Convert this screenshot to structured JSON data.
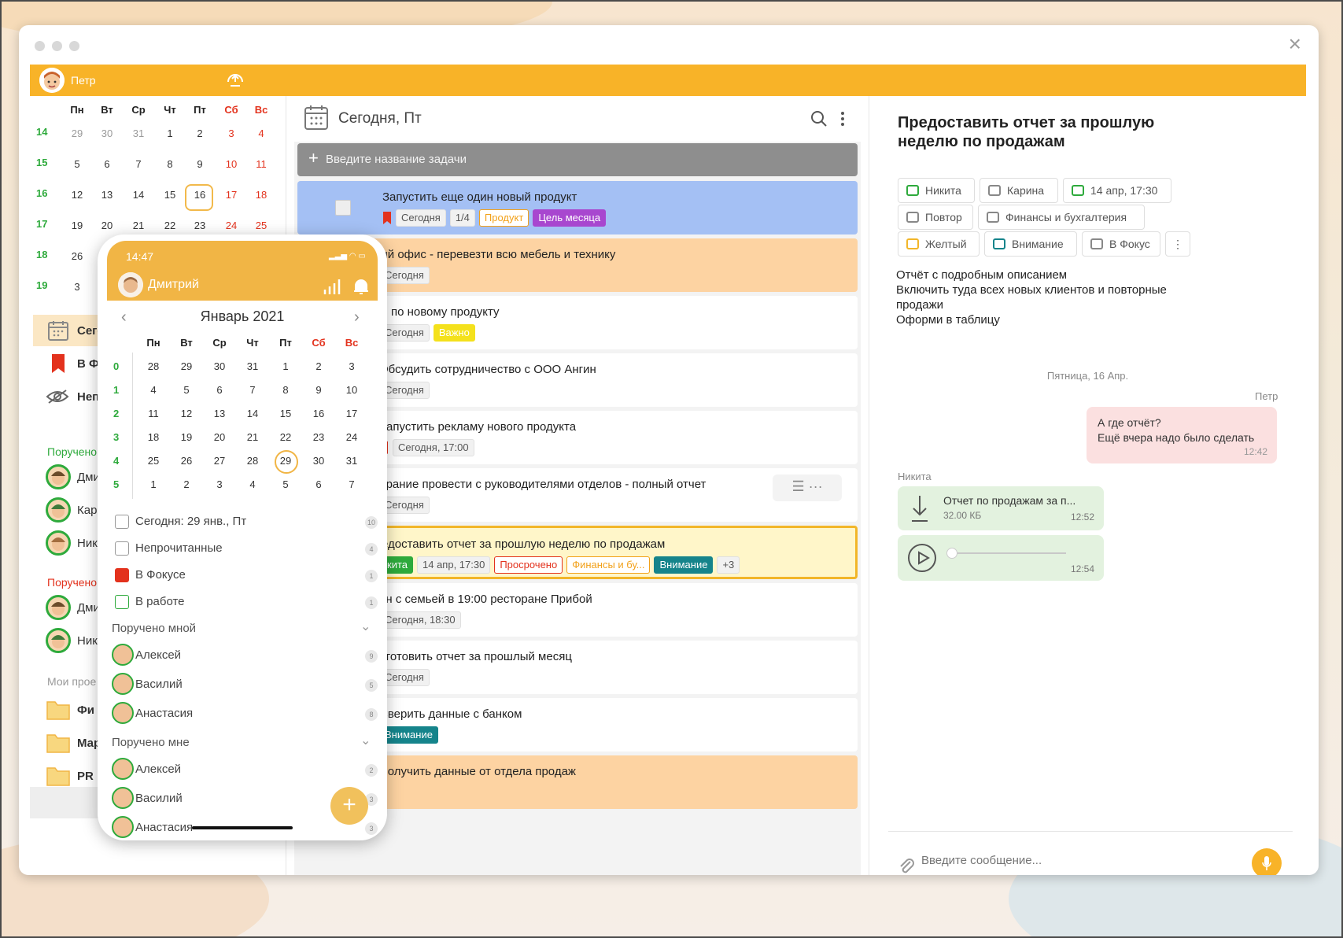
{
  "user": {
    "name": "Петр"
  },
  "calendar": {
    "weekdays": [
      "Пн",
      "Вт",
      "Ср",
      "Чт",
      "Пт",
      "Сб",
      "Вс"
    ],
    "weeks": [
      {
        "num": "14",
        "days": [
          "29",
          "30",
          "31",
          "1",
          "2",
          "3",
          "4"
        ]
      },
      {
        "num": "15",
        "days": [
          "5",
          "6",
          "7",
          "8",
          "9",
          "10",
          "11"
        ]
      },
      {
        "num": "16",
        "days": [
          "12",
          "13",
          "14",
          "15",
          "16",
          "17",
          "18"
        ]
      },
      {
        "num": "17",
        "days": [
          "19",
          "20",
          "21",
          "22",
          "23",
          "24",
          "25"
        ]
      },
      {
        "num": "18",
        "days": [
          "26",
          "",
          "",
          "",
          "",
          "",
          ""
        ]
      },
      {
        "num": "19",
        "days": [
          "3",
          "",
          "",
          "",
          "",
          "",
          ""
        ]
      }
    ]
  },
  "sidebar": {
    "items": [
      {
        "label": "Сего"
      },
      {
        "label": "В Фо"
      },
      {
        "label": "Неп"
      }
    ],
    "assigned_by_me": "Поручено",
    "assigned_by_me_people": [
      "Дми",
      "Кар",
      "Ник"
    ],
    "assigned_to_me": "Поручено",
    "assigned_to_me_people": [
      "Дми",
      "Ник"
    ],
    "projects_title": "Мои прое",
    "projects": [
      "Фи",
      "Мар",
      "PR"
    ]
  },
  "list": {
    "title": "Сегодня, Пт",
    "new_task_placeholder": "Введите название задачи",
    "tasks": [
      {
        "title": "Запустить еще один новый продукт",
        "tags": [
          "Сегодня",
          "1/4",
          "Продукт",
          "Цель месяца"
        ]
      },
      {
        "title": "ый офис - перевезти всю мебель и технику",
        "tags": [
          "Сегодня"
        ]
      },
      {
        "title": "ы по новому продукту",
        "tags": [
          "Сегодня",
          "Важно"
        ]
      },
      {
        "title": "Обсудить сотрудничество с ООО Ангин",
        "tags": [
          "Сегодня"
        ]
      },
      {
        "title": "Запустить рекламу нового продукта",
        "tags": [
          "Сегодня, 17:00"
        ]
      },
      {
        "title": "брание провести с руководителями отделов - полный отчет",
        "tags": [
          "Сегодня"
        ]
      },
      {
        "title": "едоставить отчет за прошлую неделю по продажам",
        "tags": [
          "кита",
          "14 апр, 17:30",
          "Просрочено",
          "Финансы и бу...",
          "Внимание",
          "+3"
        ]
      },
      {
        "title": "ин с семьей в 19:00 ресторане Прибой",
        "tags": [
          "Сегодня, 18:30"
        ]
      },
      {
        "title": "дготовить отчет за прошлый месяц",
        "tags": [
          "Сегодня"
        ]
      },
      {
        "title": "Сверить данные с банком",
        "tags": [
          "Внимание"
        ]
      },
      {
        "title": "Получить данные от отдела продаж",
        "tags": []
      }
    ]
  },
  "detail": {
    "title": "Предоставить отчет за прошлую неделю по продажам",
    "chips": [
      "Никита",
      "Карина",
      "14 апр, 17:30",
      "Повтор",
      "Финансы и бухгалтерия",
      "Желтый",
      "Внимание",
      "В Фокус"
    ],
    "description": [
      "Отчёт с подробным описанием",
      "Включить туда всех новых клиентов и повторные",
      "продажи",
      "Оформи в таблицу"
    ],
    "chat_date": "Пятница, 16 Апр.",
    "msg1_author": "Петр",
    "msg1_line1": "А где отчёт?",
    "msg1_line2": "Ещё вчера надо было сделать",
    "msg1_time": "12:42",
    "msg2_author": "Никита",
    "file_name": "Отчет по продажам за п...",
    "file_size": "32.00 КБ",
    "file_time": "12:52",
    "audio_time": "12:54",
    "input_placeholder": "Введите сообщение..."
  },
  "phone": {
    "time": "14:47",
    "user": "Дмитрий",
    "month": "Январь 2021",
    "weekdays": [
      "Пн",
      "Вт",
      "Ср",
      "Чт",
      "Пт",
      "Сб",
      "Вс"
    ],
    "weeks": [
      {
        "num": "0",
        "days": [
          "28",
          "29",
          "30",
          "31",
          "1",
          "2",
          "3"
        ]
      },
      {
        "num": "1",
        "days": [
          "4",
          "5",
          "6",
          "7",
          "8",
          "9",
          "10"
        ]
      },
      {
        "num": "2",
        "days": [
          "11",
          "12",
          "13",
          "14",
          "15",
          "16",
          "17"
        ]
      },
      {
        "num": "3",
        "days": [
          "18",
          "19",
          "20",
          "21",
          "22",
          "23",
          "24"
        ]
      },
      {
        "num": "4",
        "days": [
          "25",
          "26",
          "27",
          "28",
          "29",
          "30",
          "31"
        ]
      },
      {
        "num": "5",
        "days": [
          "1",
          "2",
          "3",
          "4",
          "5",
          "6",
          "7"
        ]
      }
    ],
    "rows": [
      {
        "label": "Сегодня: 29 янв., Пт",
        "count": "10"
      },
      {
        "label": "Непрочитанные",
        "count": "4"
      },
      {
        "label": "В Фокусе",
        "count": "1"
      },
      {
        "label": "В работе",
        "count": "1"
      }
    ],
    "by_me": "Поручено мной",
    "by_me_people": [
      {
        "name": "Алексей",
        "count": "9"
      },
      {
        "name": "Василий",
        "count": "5"
      },
      {
        "name": "Анастасия",
        "count": "8"
      }
    ],
    "to_me": "Поручено мне",
    "to_me_people": [
      {
        "name": "Алексей",
        "count": "2"
      },
      {
        "name": "Василий",
        "count": "3"
      },
      {
        "name": "Анастасия",
        "count": "3"
      }
    ]
  },
  "colors": {
    "accent": "#f8b328",
    "selected_task": "#a4c0f4",
    "orange_task": "#fdd3a2",
    "focus_border": "#f2b629",
    "green": "#2eaa3c",
    "red": "#e3321d"
  }
}
